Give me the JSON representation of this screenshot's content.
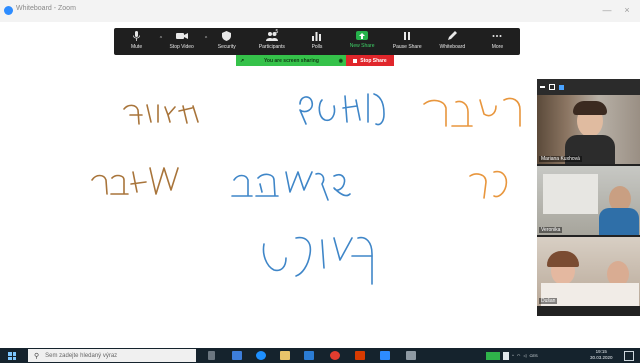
{
  "window": {
    "title": "Whiteboard - Zoom",
    "minimize": "—",
    "close": "×"
  },
  "toolbar": {
    "items": [
      {
        "label": "Mute",
        "icon": "microphone-icon"
      },
      {
        "label": "Stop Video",
        "icon": "video-camera-icon"
      },
      {
        "label": "Security",
        "icon": "shield-icon"
      },
      {
        "label": "Participants",
        "icon": "people-icon",
        "count": "5"
      },
      {
        "label": "Polls",
        "icon": "bar-chart-icon"
      },
      {
        "label": "New Share",
        "icon": "share-up-arrow-icon"
      },
      {
        "label": "Pause Share",
        "icon": "pause-icon"
      },
      {
        "label": "Whiteboard",
        "icon": "pen-icon"
      },
      {
        "label": "More",
        "icon": "ellipsis-icon"
      }
    ]
  },
  "sharing": {
    "status": "You are screen sharing",
    "stop": "Stop Share"
  },
  "whiteboard": {
    "colors": {
      "brown": "#a8743a",
      "blue": "#3f86c8",
      "orange": "#e8963d"
    }
  },
  "video_panel": {
    "participants": [
      {
        "name": "Mariana Kuxhová"
      },
      {
        "name": "Veronika"
      },
      {
        "name": "Dušan"
      }
    ]
  },
  "taskbar": {
    "search_placeholder": "Sem zadejte hledaný výraz",
    "time": "19:15",
    "date": "30.03.2020",
    "lang": "CES"
  },
  "colors": {
    "toolbar_bg": "#1f1f1f",
    "share_green": "#35c24a",
    "stop_red": "#e0262b",
    "taskbar_bg": "#15232d"
  }
}
